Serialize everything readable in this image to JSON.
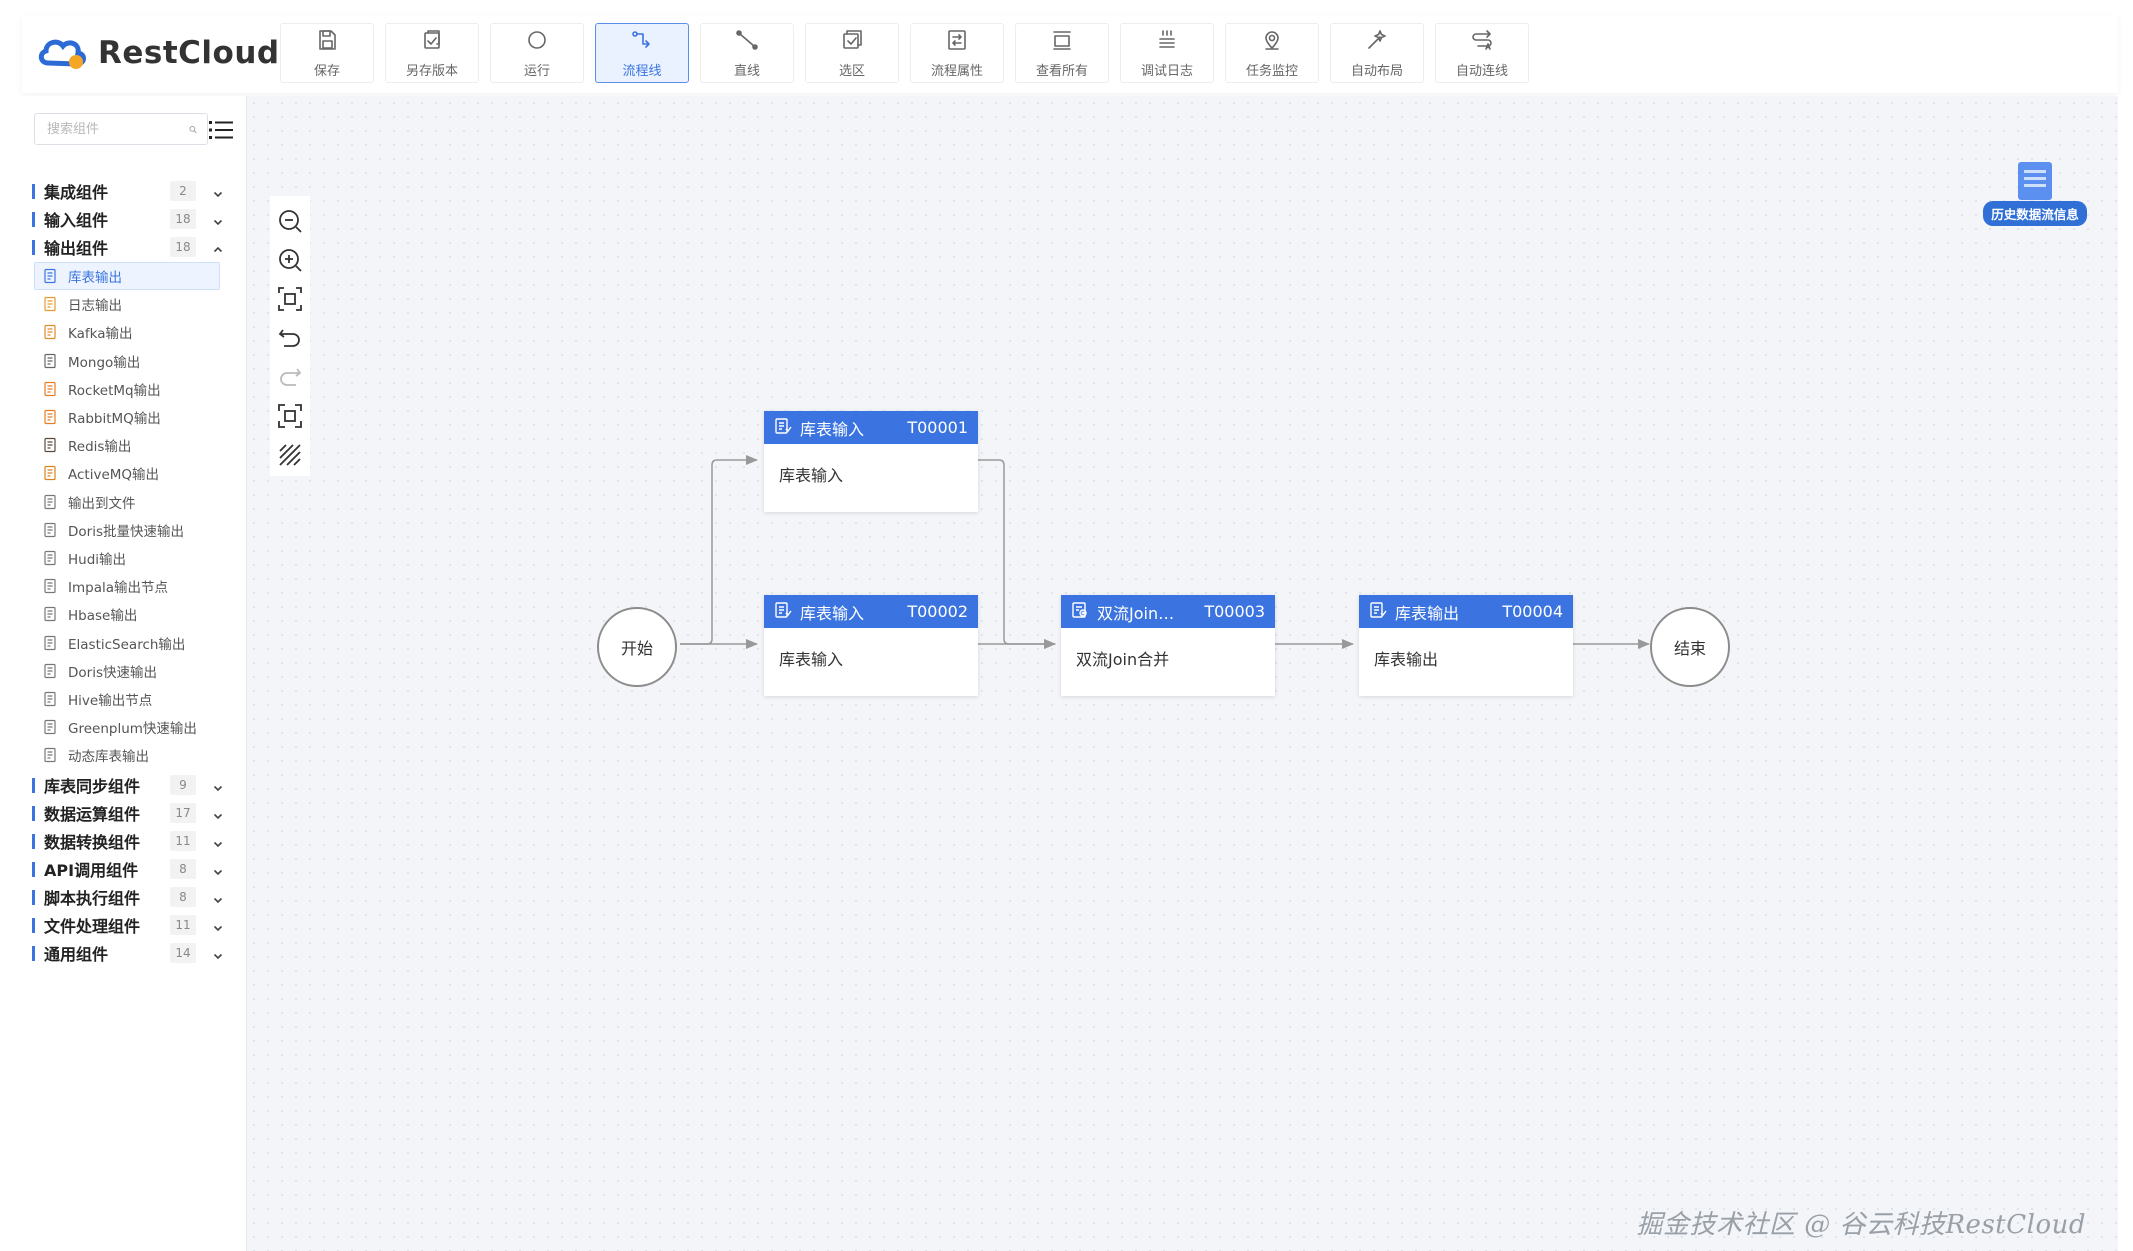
{
  "app": {
    "logo_text": "RestCloud",
    "brand_color": "#3b74e0"
  },
  "toolbar": [
    {
      "label": "保存",
      "icon": "save-icon"
    },
    {
      "label": "另存版本",
      "icon": "save-version-icon"
    },
    {
      "label": "运行",
      "icon": "run-icon"
    },
    {
      "label": "流程线",
      "icon": "flow-line-icon",
      "active": true
    },
    {
      "label": "直线",
      "icon": "straight-line-icon"
    },
    {
      "label": "选区",
      "icon": "select-area-icon"
    },
    {
      "label": "流程属性",
      "icon": "flow-properties-icon"
    },
    {
      "label": "查看所有",
      "icon": "view-all-icon"
    },
    {
      "label": "调试日志",
      "icon": "debug-log-icon"
    },
    {
      "label": "任务监控",
      "icon": "task-monitor-icon"
    },
    {
      "label": "自动布局",
      "icon": "auto-layout-icon"
    },
    {
      "label": "自动连线",
      "icon": "auto-connect-icon"
    }
  ],
  "sidebar": {
    "search_placeholder": "搜索组件",
    "categories": [
      {
        "label": "集成组件",
        "count": "2",
        "expanded": false
      },
      {
        "label": "输入组件",
        "count": "18",
        "expanded": false
      },
      {
        "label": "输出组件",
        "count": "18",
        "expanded": true
      },
      {
        "label": "库表同步组件",
        "count": "9",
        "expanded": false
      },
      {
        "label": "数据运算组件",
        "count": "17",
        "expanded": false
      },
      {
        "label": "数据转换组件",
        "count": "11",
        "expanded": false
      },
      {
        "label": "API调用组件",
        "count": "8",
        "expanded": false
      },
      {
        "label": "脚本执行组件",
        "count": "8",
        "expanded": false
      },
      {
        "label": "文件处理组件",
        "count": "11",
        "expanded": false
      },
      {
        "label": "通用组件",
        "count": "14",
        "expanded": false
      }
    ],
    "output_items": [
      {
        "label": "库表输出",
        "icon": "table-output-icon",
        "selected": true
      },
      {
        "label": "日志输出",
        "icon": "log-output-icon"
      },
      {
        "label": "Kafka输出",
        "icon": "kafka-icon"
      },
      {
        "label": "Mongo输出",
        "icon": "mongo-icon"
      },
      {
        "label": "RocketMq输出",
        "icon": "rocketmq-icon"
      },
      {
        "label": "RabbitMQ输出",
        "icon": "rabbitmq-icon"
      },
      {
        "label": "Redis输出",
        "icon": "redis-icon"
      },
      {
        "label": "ActiveMQ输出",
        "icon": "activemq-icon"
      },
      {
        "label": "输出到文件",
        "icon": "file-output-icon"
      },
      {
        "label": "Doris批量快速输出",
        "icon": "doris-batch-icon"
      },
      {
        "label": "Hudi输出",
        "icon": "hudi-icon"
      },
      {
        "label": "Impala输出节点",
        "icon": "impala-icon"
      },
      {
        "label": "Hbase输出",
        "icon": "hbase-icon"
      },
      {
        "label": "ElasticSearch输出",
        "icon": "elasticsearch-icon"
      },
      {
        "label": "Doris快速输出",
        "icon": "doris-icon"
      },
      {
        "label": "Hive输出节点",
        "icon": "hive-icon"
      },
      {
        "label": "Greenplum快速输出",
        "icon": "greenplum-icon"
      },
      {
        "label": "动态库表输出",
        "icon": "dynamic-table-icon"
      }
    ]
  },
  "canvas": {
    "zoom_tools": [
      "zoom-out-icon",
      "zoom-in-icon",
      "fit-view-icon",
      "undo-icon",
      "redo-icon",
      "fullscreen-icon",
      "grid-toggle-icon"
    ],
    "history_label": "历史数据流信息",
    "start_label": "开始",
    "end_label": "结束",
    "nodes": [
      {
        "title": "库表输入",
        "id": "T00001",
        "body": "库表输入"
      },
      {
        "title": "库表输入",
        "id": "T00002",
        "body": "库表输入"
      },
      {
        "title": "双流Join…",
        "id": "T00003",
        "body": "双流Join合并"
      },
      {
        "title": "库表输出",
        "id": "T00004",
        "body": "库表输出"
      }
    ]
  },
  "watermark": "掘金技术社区 @ 谷云科技RestCloud"
}
